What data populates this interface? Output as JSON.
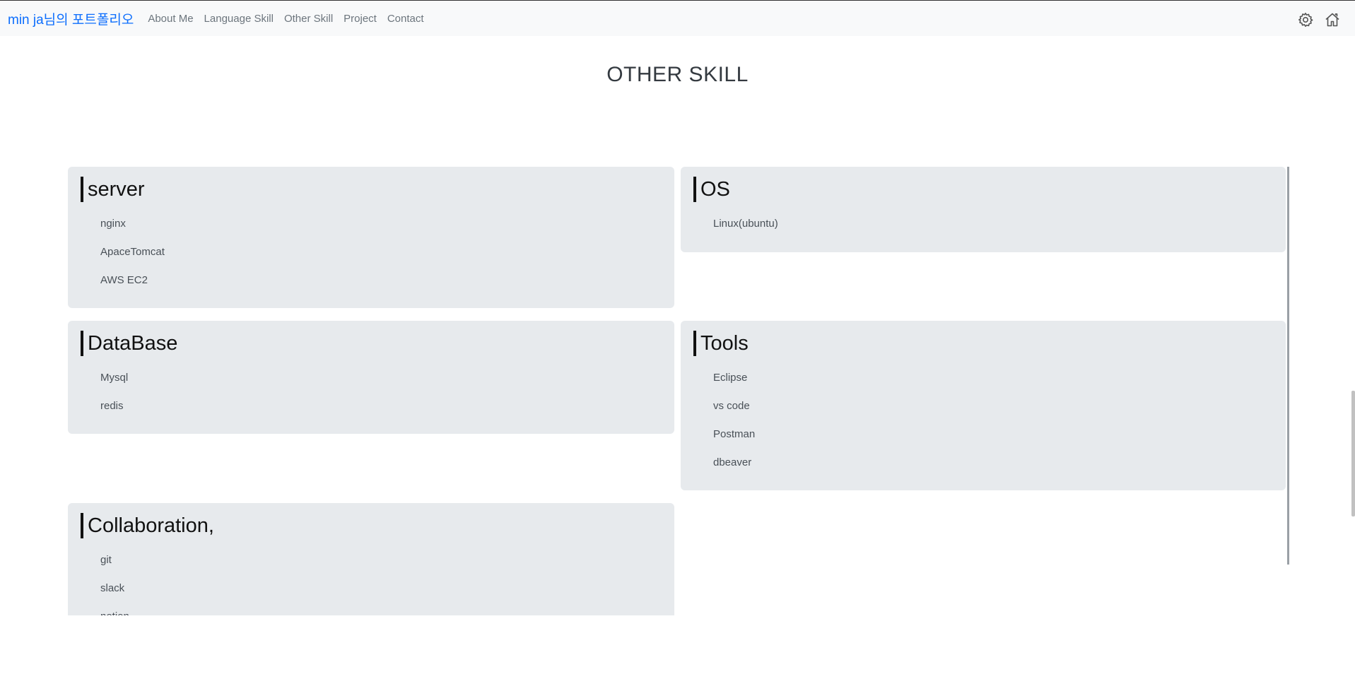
{
  "navbar": {
    "brand": "min ja님의 포트폴리오",
    "links": [
      "About Me",
      "Language Skill",
      "Other Skill",
      "Project",
      "Contact"
    ],
    "icons": [
      "gear-icon",
      "home-icon"
    ]
  },
  "section": {
    "title": "OTHER SKILL"
  },
  "cards": {
    "server": {
      "title": "server",
      "items": [
        "nginx",
        "ApaceTomcat",
        "AWS EC2"
      ]
    },
    "os": {
      "title": "OS",
      "items": [
        "Linux(ubuntu)"
      ]
    },
    "database": {
      "title": "DataBase",
      "items": [
        "Mysql",
        "redis"
      ]
    },
    "tools": {
      "title": "Tools",
      "items": [
        "Eclipse",
        "vs code",
        "Postman",
        "dbeaver"
      ]
    },
    "collaboration": {
      "title": "Collaboration,",
      "items": [
        "git",
        "slack",
        "notion"
      ]
    }
  },
  "colors": {
    "brand": "#0d6efd",
    "navbar_bg": "#f8f9fa",
    "card_bg": "#e7eaed"
  }
}
